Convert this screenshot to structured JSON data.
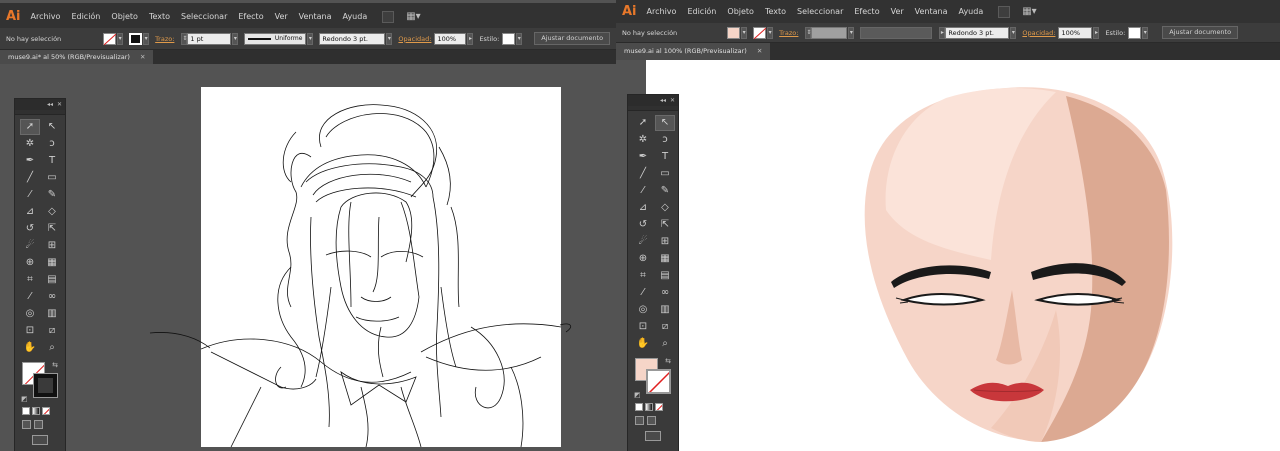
{
  "app": {
    "logo": "Ai",
    "accent": "#e8782a"
  },
  "menu": [
    "Archivo",
    "Edición",
    "Objeto",
    "Texto",
    "Seleccionar",
    "Efecto",
    "Ver",
    "Ventana",
    "Ayuda"
  ],
  "control_bar": {
    "selection": "No hay selección",
    "trazo_label": "Trazo:",
    "stroke_weight": "1 pt",
    "stroke_profile": "Uniforme",
    "brush": "Redondo 3 pt.",
    "opacity_label": "Opacidad:",
    "opacity_value": "100%",
    "style_label": "Estilo:",
    "fit_button": "Ajustar documento"
  },
  "left_window": {
    "doc_tab": "muse9.ai* al 50% (RGB/Previsualizar)",
    "fill": "none",
    "stroke": "black"
  },
  "right_window": {
    "doc_tab": "muse9.ai al 100% (RGB/Previsualizar)",
    "fill_color": "#f6d5c8",
    "stroke": "none"
  },
  "tools": [
    [
      "selection-tool",
      "direct-selection-tool"
    ],
    [
      "magic-wand-tool",
      "lasso-tool"
    ],
    [
      "pen-tool",
      "type-tool"
    ],
    [
      "line-segment-tool",
      "rectangle-tool"
    ],
    [
      "paintbrush-tool",
      "pencil-tool"
    ],
    [
      "blob-brush-tool",
      "eraser-tool"
    ],
    [
      "rotate-tool",
      "scale-tool"
    ],
    [
      "warp-tool",
      "free-transform-tool"
    ],
    [
      "shape-builder-tool",
      "perspective-grid-tool"
    ],
    [
      "mesh-tool",
      "gradient-tool"
    ],
    [
      "eyedropper-tool",
      "blend-tool"
    ],
    [
      "symbol-sprayer-tool",
      "column-graph-tool"
    ],
    [
      "artboard-tool",
      "slice-tool"
    ],
    [
      "hand-tool",
      "zoom-tool"
    ]
  ],
  "tool_glyphs": {
    "selection-tool": "➚",
    "direct-selection-tool": "↖",
    "magic-wand-tool": "✲",
    "lasso-tool": "ↄ",
    "pen-tool": "✒",
    "type-tool": "T",
    "line-segment-tool": "╱",
    "rectangle-tool": "▭",
    "paintbrush-tool": "⁄",
    "pencil-tool": "✎",
    "blob-brush-tool": "⊿",
    "eraser-tool": "◇",
    "rotate-tool": "↺",
    "scale-tool": "⇱",
    "warp-tool": "☄",
    "free-transform-tool": "⊞",
    "shape-builder-tool": "⊕",
    "perspective-grid-tool": "▦",
    "mesh-tool": "⌗",
    "gradient-tool": "▤",
    "eyedropper-tool": "⁄",
    "blend-tool": "∞",
    "symbol-sprayer-tool": "◎",
    "column-graph-tool": "▥",
    "artboard-tool": "⊡",
    "slice-tool": "⧄",
    "hand-tool": "✋",
    "zoom-tool": "⌕"
  },
  "face_colors": {
    "skin_light": "#f6d5c8",
    "skin_mid": "#f1c9b8",
    "skin_shadow": "#dca992",
    "lips": "#c8373b",
    "brows": "#1a1a1a"
  }
}
